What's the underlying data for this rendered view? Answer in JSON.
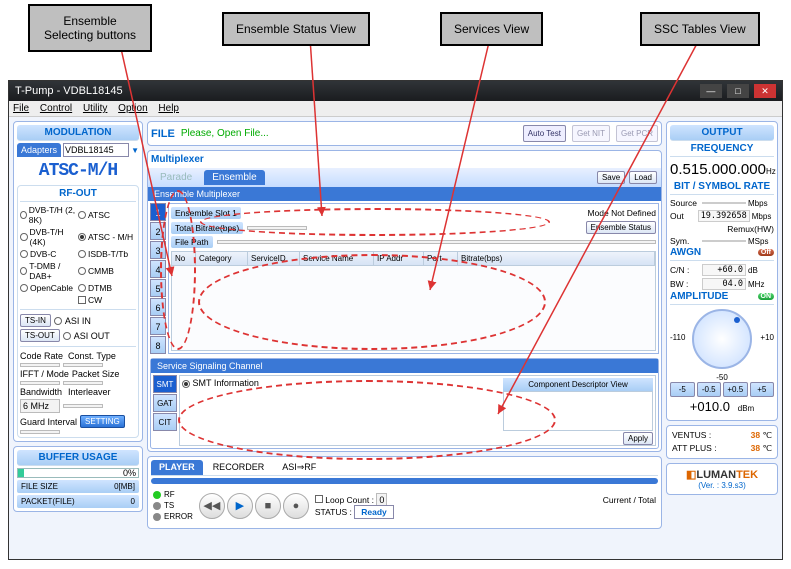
{
  "callouts": {
    "ensemble_btns": "Ensemble\nSelecting buttons",
    "ensemble_status": "Ensemble Status View",
    "services": "Services View",
    "ssc": "SSC Tables View"
  },
  "titlebar": {
    "title": "T-Pump - VDBL18145"
  },
  "menu": {
    "file": "File",
    "control": "Control",
    "utility": "Utility",
    "option": "Option",
    "help": "Help"
  },
  "modulation": {
    "title": "MODULATION",
    "adapters_tab": "Adapters",
    "adapter": "VDBL18145",
    "model": "ATSC-M/H",
    "rfout_title": "RF-OUT",
    "rows": [
      [
        "DVB-T/H (2, 8K)",
        "ATSC"
      ],
      [
        "DVB-T/H (4K)",
        "ATSC - M/H"
      ],
      [
        "DVB-C",
        "ISDB-T/Tb"
      ],
      [
        "T-DMB / DAB+",
        "CMMB"
      ],
      [
        "OpenCable",
        "DTMB"
      ],
      [
        "",
        "CW"
      ]
    ],
    "tsin": "TS-IN",
    "asiin": "ASI IN",
    "tsout": "TS-OUT",
    "asiout": "ASI OUT",
    "coderate": "Code Rate",
    "consttype": "Const. Type",
    "ifftmode": "IFFT / Mode",
    "packetsize": "Packet Size",
    "bandwidth": "Bandwidth",
    "interleaver": "Interleaver",
    "bw_val": "6 MHz",
    "guard": "Guard Interval",
    "setting": "SETTING"
  },
  "buffer": {
    "title": "BUFFER USAGE",
    "pct": "0%",
    "filesize_lbl": "FILE SIZE",
    "filesize": "0[MB]",
    "packet_lbl": "PACKET(FILE)",
    "packet": "0"
  },
  "filebar": {
    "label": "FILE",
    "msg": "Please, Open File...",
    "auto": "Auto\nTest",
    "get": "Get\nNIT",
    "getpcr": "Get\nPCR"
  },
  "mux": {
    "title": "Multiplexer",
    "tab_parade": "Parade",
    "tab_ensemble": "Ensemble",
    "save": "Save",
    "load": "Load",
    "sub": "Ensemble  Multiplexer",
    "nums": [
      "1",
      "2",
      "3",
      "4",
      "5",
      "6",
      "7",
      "8"
    ],
    "slot_lbl": "Ensemble Slot 1",
    "mode_lbl": "Mode Not Defined",
    "bitrate_lbl": "Total Bitrate(bps)",
    "ens_status_btn": "Ensemble  Status",
    "filepath_lbl": "File Path",
    "cols": {
      "no": "No",
      "cat": "Category",
      "sid": "ServiceID",
      "sname": "Service Name",
      "ip": "IP Addr",
      "port": "Port",
      "br": "Bitrate(bps)"
    }
  },
  "ssc": {
    "head": "Service Signaling Channel",
    "tabs": [
      "SMT",
      "GAT",
      "CIT"
    ],
    "smt": "SMT Information",
    "comp_lbl": "Component Descriptor View",
    "apply": "Apply"
  },
  "player": {
    "tabs": {
      "player": "PLAYER",
      "recorder": "RECORDER",
      "asirf": "ASI⇒RF"
    },
    "leds": {
      "rf": "RF",
      "ts": "TS",
      "err": "ERROR"
    },
    "loop_lbl": "Loop Count :",
    "loop_val": "0",
    "status_lbl": "STATUS :",
    "status_val": "Ready",
    "ct_lbl": "Current / Total"
  },
  "output": {
    "title": "OUTPUT",
    "freq_title": "FREQUENCY",
    "freq": "0.515.000.000",
    "freq_unit": "Hz",
    "bitsym_title": "BIT / SYMBOL RATE",
    "src_lbl": "Source",
    "src_unit": "Mbps",
    "out_lbl": "Out",
    "out_val": "19.392658",
    "out_unit": "Mbps",
    "remux": "Remux(HW)",
    "sym_lbl": "Sym.",
    "sym_unit": "MSps",
    "awgn_title": "AWGN",
    "awgn_off": "Off",
    "cn_lbl": "C/N :",
    "cn_val": "+60.0",
    "cn_unit": "dB",
    "bw_lbl": "BW :",
    "bw_val": "04.0",
    "bw_unit": "MHz",
    "amp_title": "AMPLITUDE",
    "amp_on": "ON",
    "minus110": "-110",
    "plus10": "+10",
    "minus50": "-50",
    "steps": [
      "-5",
      "-0.5",
      "+0.5",
      "+5"
    ],
    "amp_val": "+010.0",
    "amp_unit": "dBm"
  },
  "temps": {
    "ventus_lbl": "VENTUS :",
    "ventus": "38",
    "unit": "℃",
    "att_lbl": "ATT PLUS :",
    "att": "38"
  },
  "logo": {
    "brand_pre": "LUMAN",
    "brand_post": "TEK",
    "ver": "(Ver. : 3.9.s3)"
  }
}
